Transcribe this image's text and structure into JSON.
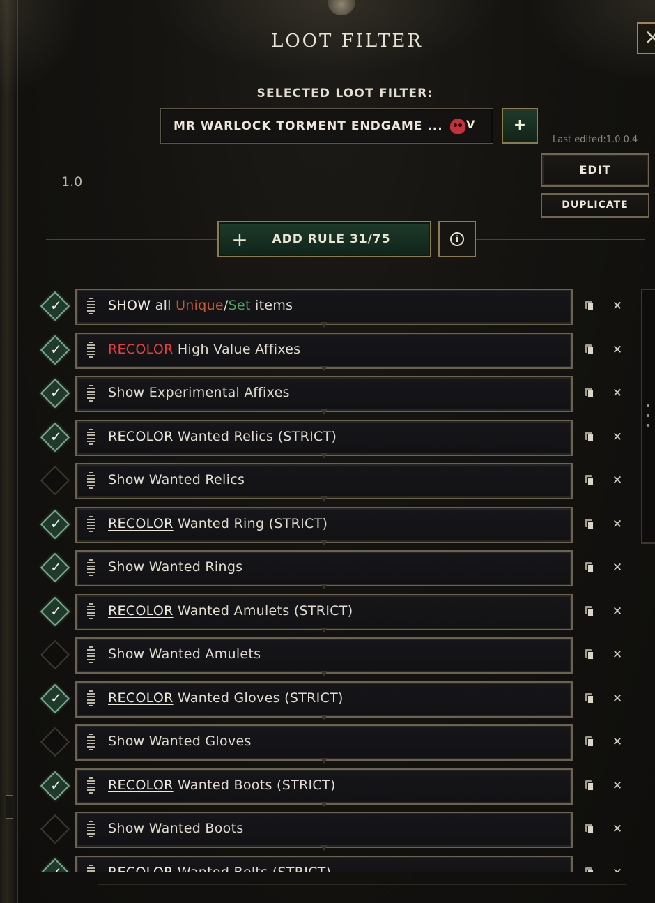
{
  "window": {
    "title": "LOOT FILTER",
    "close_icon": "×"
  },
  "selector": {
    "label": "SELECTED LOOT FILTER:",
    "current": "MR WARLOCK TORMENT ENDGAME ...",
    "skull_icon": "skull-icon",
    "arrow": "V",
    "add_label": "+",
    "last_edited": "Last edited:1.0.0.4"
  },
  "version": "1.0",
  "buttons": {
    "edit": "EDIT",
    "duplicate": "DUPLICATE",
    "add_rule_plus": "+",
    "add_rule": "ADD RULE 31/75",
    "info": "i"
  },
  "colors": {
    "accent_green": "#1d3a2a",
    "gold_border": "#8d7a4d",
    "recolor_red": "#e0403f",
    "unique": "#c45a2a",
    "set": "#4fa259"
  },
  "rules": [
    {
      "enabled": true,
      "parts": [
        "SHOW",
        " all ",
        "Unique",
        "/",
        "Set",
        " items"
      ]
    },
    {
      "enabled": true,
      "keyword": "RECOLOR",
      "rest": " High Value Affixes"
    },
    {
      "enabled": true,
      "text": "Show Experimental Affixes"
    },
    {
      "enabled": true,
      "keyword": "RECOLOR",
      "rest": " Wanted Relics (STRICT)"
    },
    {
      "enabled": false,
      "text": "Show Wanted Relics"
    },
    {
      "enabled": true,
      "keyword": "RECOLOR",
      "rest": " Wanted Ring (STRICT)"
    },
    {
      "enabled": true,
      "text": "Show Wanted Rings"
    },
    {
      "enabled": true,
      "keyword": "RECOLOR",
      "rest": " Wanted Amulets (STRICT)"
    },
    {
      "enabled": false,
      "text": "Show Wanted Amulets"
    },
    {
      "enabled": true,
      "keyword": "RECOLOR",
      "rest": " Wanted Gloves (STRICT)"
    },
    {
      "enabled": false,
      "text": "Show Wanted Gloves"
    },
    {
      "enabled": true,
      "keyword": "RECOLOR",
      "rest": " Wanted Boots (STRICT)"
    },
    {
      "enabled": false,
      "text": "Show Wanted Boots"
    },
    {
      "enabled": true,
      "keyword": "RECOLOR",
      "rest": " Wanted Belts (STRICT)"
    }
  ],
  "rule_actions": {
    "check_mark": "✓",
    "delete": "✕"
  }
}
